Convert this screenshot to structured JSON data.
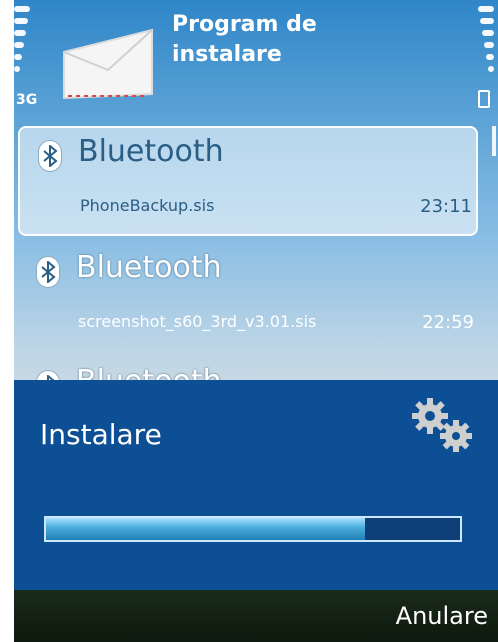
{
  "status": {
    "network": "3G"
  },
  "header": {
    "title_line1": "Program de",
    "title_line2": "instalare"
  },
  "list": [
    {
      "title": "Bluetooth",
      "file": "PhoneBackup.sis",
      "time": "23:11",
      "selected": true
    },
    {
      "title": "Bluetooth",
      "file": "screenshot_s60_3rd_v3.01.sis",
      "time": "22:59",
      "selected": false
    },
    {
      "title": "Bluetooth",
      "file": "",
      "time": "",
      "selected": false
    }
  ],
  "dialog": {
    "title": "Instalare",
    "progress": 0.77
  },
  "softkeys": {
    "right": "Anulare"
  },
  "colors": {
    "dialog_bg": "#0d4f95",
    "accent": "#2a5e85"
  }
}
